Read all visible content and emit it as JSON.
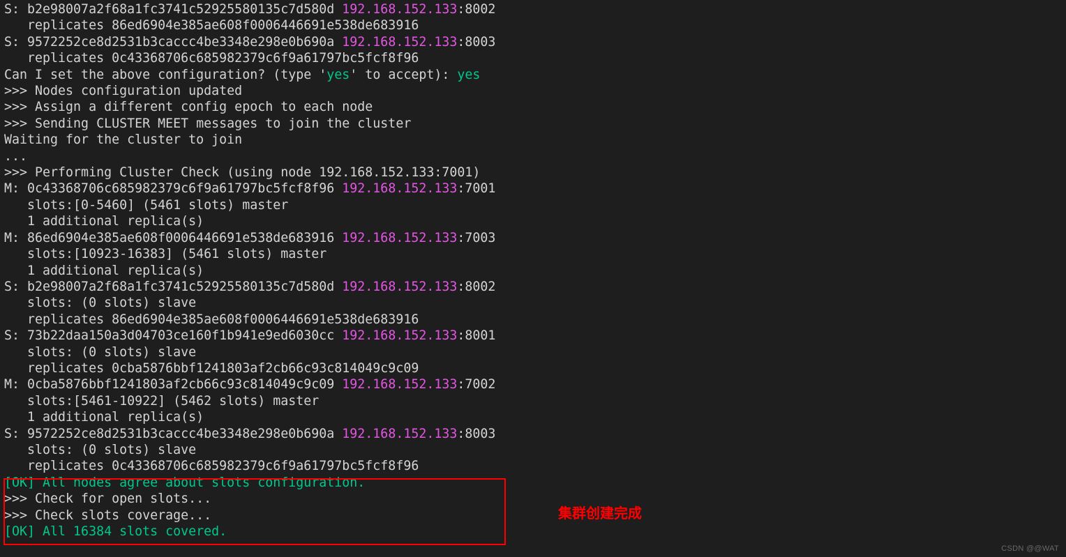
{
  "lines": [
    [
      {
        "t": "S: b2e98007a2f68a1fc3741c52925580135c7d580d "
      },
      {
        "t": "192.168.152.133",
        "c": "ip"
      },
      {
        "t": ":8002"
      }
    ],
    [
      {
        "t": "   replicates 86ed6904e385ae608f0006446691e538de683916"
      }
    ],
    [
      {
        "t": "S: 9572252ce8d2531b3caccc4be3348e298e0b690a "
      },
      {
        "t": "192.168.152.133",
        "c": "ip"
      },
      {
        "t": ":8003"
      }
    ],
    [
      {
        "t": "   replicates 0c43368706c685982379c6f9a61797bc5fcf8f96"
      }
    ],
    [
      {
        "t": "Can I set the above configuration? (type '"
      },
      {
        "t": "yes",
        "c": "grn"
      },
      {
        "t": "' to accept): "
      },
      {
        "t": "yes",
        "c": "grn"
      }
    ],
    [
      {
        "t": ">>> Nodes configuration updated"
      }
    ],
    [
      {
        "t": ">>> Assign a different config epoch to each node"
      }
    ],
    [
      {
        "t": ">>> Sending CLUSTER MEET messages to join the cluster"
      }
    ],
    [
      {
        "t": "Waiting for the cluster to join"
      }
    ],
    [
      {
        "t": "..."
      }
    ],
    [
      {
        "t": ">>> Performing Cluster Check (using node 192.168.152.133:7001)"
      }
    ],
    [
      {
        "t": "M: 0c43368706c685982379c6f9a61797bc5fcf8f96 "
      },
      {
        "t": "192.168.152.133",
        "c": "ip"
      },
      {
        "t": ":7001"
      }
    ],
    [
      {
        "t": "   slots:[0-5460] (5461 slots) master"
      }
    ],
    [
      {
        "t": "   1 additional replica(s)"
      }
    ],
    [
      {
        "t": "M: 86ed6904e385ae608f0006446691e538de683916 "
      },
      {
        "t": "192.168.152.133",
        "c": "ip"
      },
      {
        "t": ":7003"
      }
    ],
    [
      {
        "t": "   slots:[10923-16383] (5461 slots) master"
      }
    ],
    [
      {
        "t": "   1 additional replica(s)"
      }
    ],
    [
      {
        "t": "S: b2e98007a2f68a1fc3741c52925580135c7d580d "
      },
      {
        "t": "192.168.152.133",
        "c": "ip"
      },
      {
        "t": ":8002"
      }
    ],
    [
      {
        "t": "   slots: (0 slots) slave"
      }
    ],
    [
      {
        "t": "   replicates 86ed6904e385ae608f0006446691e538de683916"
      }
    ],
    [
      {
        "t": "S: 73b22daa150a3d04703ce160f1b941e9ed6030cc "
      },
      {
        "t": "192.168.152.133",
        "c": "ip"
      },
      {
        "t": ":8001"
      }
    ],
    [
      {
        "t": "   slots: (0 slots) slave"
      }
    ],
    [
      {
        "t": "   replicates 0cba5876bbf1241803af2cb66c93c814049c9c09"
      }
    ],
    [
      {
        "t": "M: 0cba5876bbf1241803af2cb66c93c814049c9c09 "
      },
      {
        "t": "192.168.152.133",
        "c": "ip"
      },
      {
        "t": ":7002"
      }
    ],
    [
      {
        "t": "   slots:[5461-10922] (5462 slots) master"
      }
    ],
    [
      {
        "t": "   1 additional replica(s)"
      }
    ],
    [
      {
        "t": "S: 9572252ce8d2531b3caccc4be3348e298e0b690a "
      },
      {
        "t": "192.168.152.133",
        "c": "ip"
      },
      {
        "t": ":8003"
      }
    ],
    [
      {
        "t": "   slots: (0 slots) slave"
      }
    ],
    [
      {
        "t": "   replicates 0c43368706c685982379c6f9a61797bc5fcf8f96"
      }
    ],
    [
      {
        "t": "[OK] All nodes agree about slots configuration.",
        "c": "grn"
      }
    ],
    [
      {
        "t": ">>> Check for open slots..."
      }
    ],
    [
      {
        "t": ">>> Check slots coverage..."
      }
    ],
    [
      {
        "t": "[OK] All 16384 slots covered.",
        "c": "grn"
      }
    ]
  ],
  "annotation": "集群创建完成",
  "watermark": "CSDN @@WAT"
}
